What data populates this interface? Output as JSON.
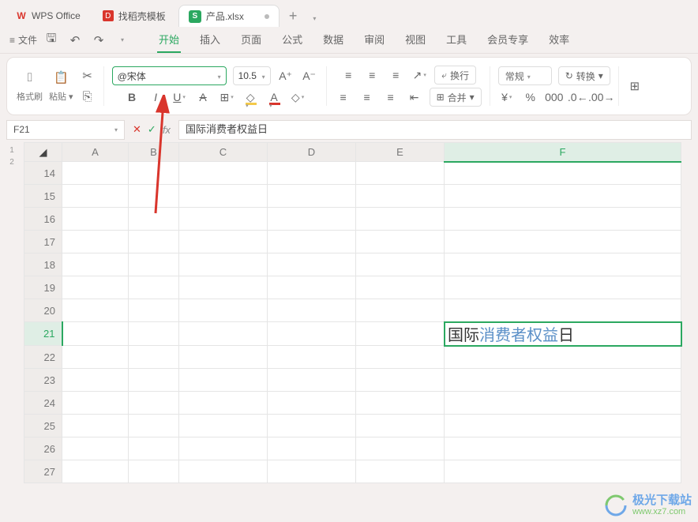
{
  "tabs": {
    "home": "WPS Office",
    "template": "找稻壳模板",
    "file": "产品.xlsx"
  },
  "menubar": {
    "file": "文件",
    "items": [
      "开始",
      "插入",
      "页面",
      "公式",
      "数据",
      "审阅",
      "视图",
      "工具",
      "会员专享",
      "效率"
    ],
    "active": "开始"
  },
  "toolbar": {
    "format_painter": "格式刷",
    "paste": "粘贴",
    "font_name": "@宋体",
    "font_size": "10.5",
    "wrap": "换行",
    "merge": "合并",
    "normal": "常规",
    "transform": "转换"
  },
  "formula_bar": {
    "name_box": "F21",
    "fx_value": "国际消费者权益日"
  },
  "grid": {
    "columns": [
      "A",
      "B",
      "C",
      "D",
      "E",
      "F"
    ],
    "rows": [
      "14",
      "15",
      "16",
      "17",
      "18",
      "19",
      "20",
      "21",
      "22",
      "23",
      "24",
      "25",
      "26",
      "27"
    ],
    "active_col": "F",
    "active_row": "21",
    "active_cell_parts": {
      "p1": "国际",
      "p2": "消费者权益",
      "p3": "日"
    }
  },
  "sheet_nav": {
    "a": "1",
    "b": "2"
  },
  "watermark": {
    "t1": "极光下载站",
    "t2": "www.xz7.com"
  }
}
